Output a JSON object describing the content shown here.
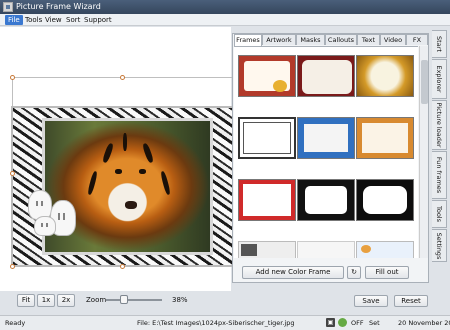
{
  "window": {
    "title": "Picture Frame Wizard"
  },
  "menu": {
    "items": [
      "File",
      "Tools",
      "View",
      "Sort",
      "Support"
    ]
  },
  "panel": {
    "tabs": [
      "Frames",
      "Artwork",
      "Masks",
      "Callouts",
      "Text",
      "Video",
      "FX"
    ],
    "add_frame_label": "Add new Color Frame",
    "fill_out_label": "Fill out"
  },
  "side_tabs": [
    "Start",
    "Explorer",
    "Picture loader",
    "Fun frames",
    "Tools",
    "Settings"
  ],
  "zoom": {
    "fit": "Fit",
    "x1": "1x",
    "x2": "2x",
    "label": "Zoom",
    "value": "38%",
    "level": 0.38
  },
  "actions": {
    "save": "Save",
    "reset": "Reset"
  },
  "status": {
    "left": "Ready",
    "file": "File: E:\\Test Images\\1024px-Siberischer_tiger.jpg",
    "toggle_value": "OFF",
    "toggle_label": "Set",
    "date": "20 November 2017"
  }
}
